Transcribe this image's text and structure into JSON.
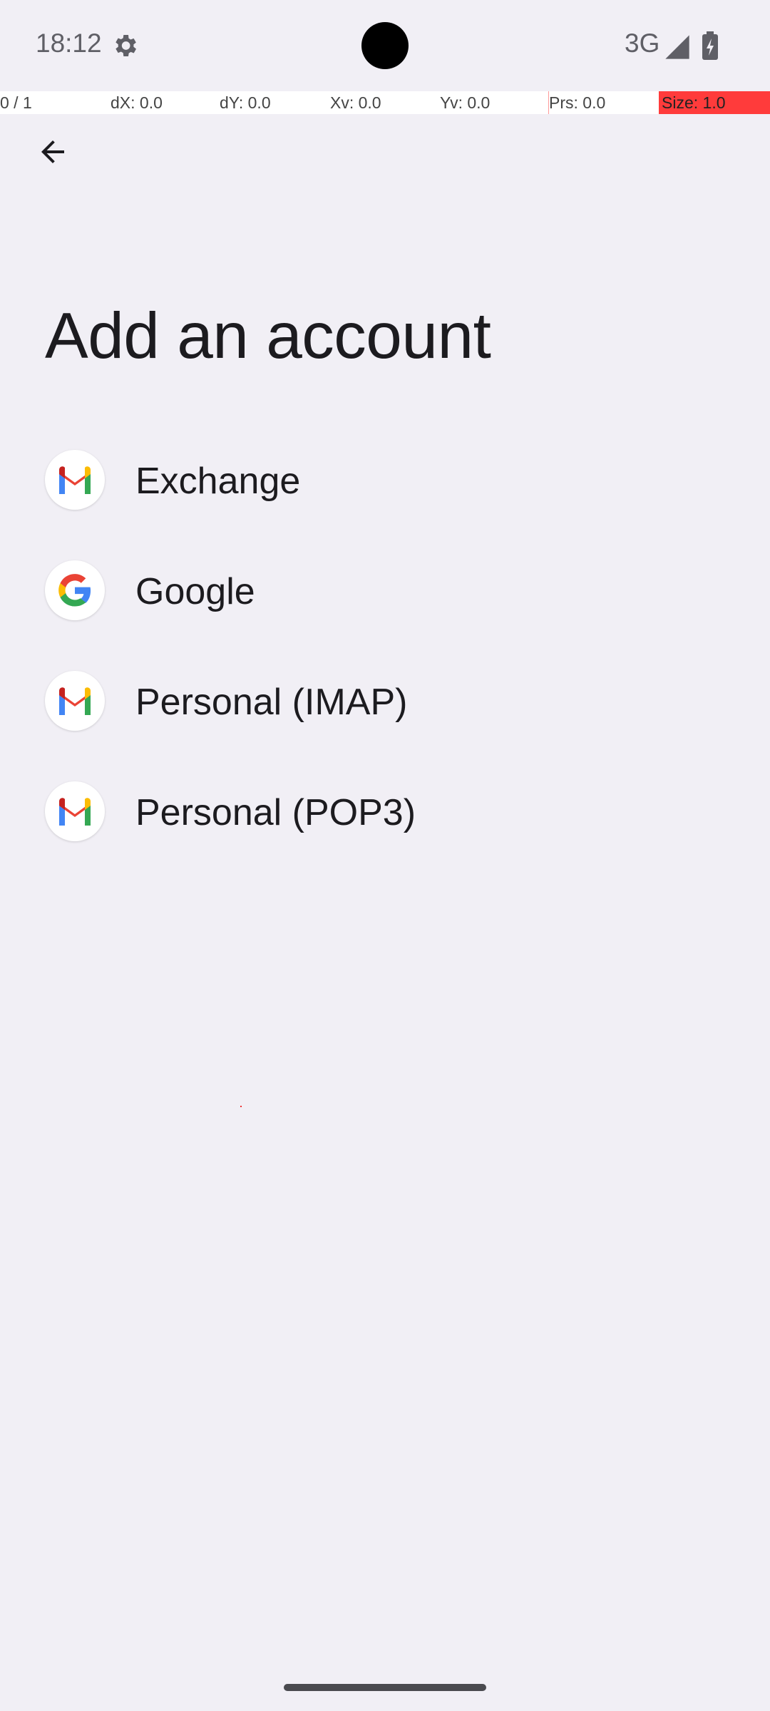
{
  "status_bar": {
    "time": "18:12",
    "network": "3G"
  },
  "pointer_location": {
    "pointers": "0 / 1",
    "dx": "dX: 0.0",
    "dy": "dY: 0.0",
    "xv": "Xv: 0.0",
    "yv": "Yv: 0.0",
    "prs": "Prs: 0.0",
    "size": "Size: 1.0"
  },
  "page": {
    "title": "Add an account"
  },
  "accounts": [
    {
      "label": "Exchange",
      "icon": "gmail-icon"
    },
    {
      "label": "Google",
      "icon": "google-icon"
    },
    {
      "label": "Personal (IMAP)",
      "icon": "gmail-icon"
    },
    {
      "label": "Personal (POP3)",
      "icon": "gmail-icon"
    }
  ],
  "colors": {
    "background": "#f1eff5",
    "size_highlight": "#ff3b3b"
  }
}
